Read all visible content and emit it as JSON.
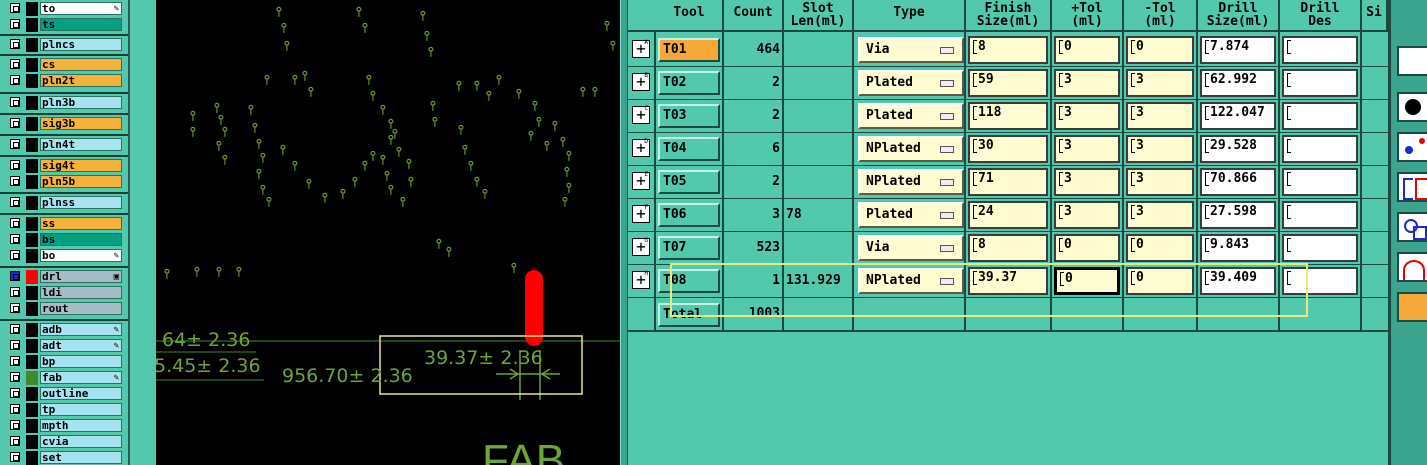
{
  "layers": {
    "items": [
      {
        "name": "to",
        "color": "#ffffff",
        "edit": true
      },
      {
        "name": "ts",
        "color": "#00a080",
        "edit": false
      },
      {
        "name": "plncs",
        "color": "#a8e4f0",
        "edit": false
      },
      {
        "name": "cs",
        "color": "#f7b23b",
        "edit": false
      },
      {
        "name": "pln2t",
        "color": "#f7b23b",
        "edit": false
      },
      {
        "name": "pln3b",
        "color": "#a8e4f0",
        "edit": false
      },
      {
        "name": "sig3b",
        "color": "#f7b23b",
        "edit": false
      },
      {
        "name": "pln4t",
        "color": "#a8e4f0",
        "edit": false
      },
      {
        "name": "sig4t",
        "color": "#f7b23b",
        "edit": false
      },
      {
        "name": "pln5b",
        "color": "#f7b23b",
        "edit": false
      },
      {
        "name": "plnss",
        "color": "#a8e4f0",
        "edit": false
      },
      {
        "name": "ss",
        "color": "#f7b23b",
        "edit": false
      },
      {
        "name": "bs",
        "color": "#00a080",
        "edit": false
      },
      {
        "name": "bo",
        "color": "#ffffff",
        "edit": true
      },
      {
        "name": "drl",
        "color": "#a8bcc8",
        "edit": false
      },
      {
        "name": "ldi",
        "color": "#a8bcc8",
        "edit": false
      },
      {
        "name": "rout",
        "color": "#a8bcc8",
        "edit": false
      },
      {
        "name": "adb",
        "color": "#a8e4f0",
        "edit": true
      },
      {
        "name": "adt",
        "color": "#a8e4f0",
        "edit": true
      },
      {
        "name": "bp",
        "color": "#a8e4f0",
        "edit": false
      },
      {
        "name": "fab",
        "color": "#a8e4f0",
        "edit": true
      },
      {
        "name": "outline",
        "color": "#a8e4f0",
        "edit": false
      },
      {
        "name": "tp",
        "color": "#a8e4f0",
        "edit": false
      },
      {
        "name": "mpth",
        "color": "#a8e4f0",
        "edit": false
      },
      {
        "name": "cvia",
        "color": "#a8e4f0",
        "edit": false
      },
      {
        "name": "set",
        "color": "#a8e4f0",
        "edit": false
      }
    ]
  },
  "canvas": {
    "dims": [
      "64± 2.36",
      "5.45± 2.36",
      "956.70± 2.36",
      "39.37± 2.36"
    ],
    "fab_text": "FAB"
  },
  "table": {
    "headers": [
      {
        "l1": "Tool",
        "l2": ""
      },
      {
        "l1": "Count",
        "l2": ""
      },
      {
        "l1": "Slot",
        "l2": "Len(ml)"
      },
      {
        "l1": "Type",
        "l2": ""
      },
      {
        "l1": "Finish",
        "l2": "Size(ml)"
      },
      {
        "l1": "+Tol",
        "l2": "(ml)"
      },
      {
        "l1": "-Tol",
        "l2": "(ml)"
      },
      {
        "l1": "Drill",
        "l2": "Size(ml)"
      },
      {
        "l1": "Drill",
        "l2": "Des"
      },
      {
        "l1": "Si",
        "l2": ""
      }
    ],
    "rows": [
      {
        "sub": "A",
        "tool": "T01",
        "count": "464",
        "slot": "",
        "type": "Via",
        "finish": "8",
        "plus": "0",
        "minus": "0",
        "drill": "7.874",
        "des": ""
      },
      {
        "sub": "B",
        "tool": "T02",
        "count": "2",
        "slot": "",
        "type": "Plated",
        "finish": "59",
        "plus": "3",
        "minus": "3",
        "drill": "62.992",
        "des": ""
      },
      {
        "sub": "C",
        "tool": "T03",
        "count": "2",
        "slot": "",
        "type": "Plated",
        "finish": "118",
        "plus": "3",
        "minus": "3",
        "drill": "122.047",
        "des": ""
      },
      {
        "sub": "D",
        "tool": "T04",
        "count": "6",
        "slot": "",
        "type": "NPlated",
        "finish": "30",
        "plus": "3",
        "minus": "3",
        "drill": "29.528",
        "des": ""
      },
      {
        "sub": "E",
        "tool": "T05",
        "count": "2",
        "slot": "",
        "type": "NPlated",
        "finish": "71",
        "plus": "3",
        "minus": "3",
        "drill": "70.866",
        "des": ""
      },
      {
        "sub": "F",
        "tool": "T06",
        "count": "3",
        "slot": "78",
        "type": "Plated",
        "finish": "24",
        "plus": "3",
        "minus": "3",
        "drill": "27.598",
        "des": ""
      },
      {
        "sub": "G",
        "tool": "T07",
        "count": "523",
        "slot": "",
        "type": "Via",
        "finish": "8",
        "plus": "0",
        "minus": "0",
        "drill": "9.843",
        "des": ""
      },
      {
        "sub": "H",
        "tool": "T08",
        "count": "1",
        "slot": "131.929",
        "type": "NPlated",
        "finish": "39.37",
        "plus": "0",
        "minus": "0",
        "drill": "39.409",
        "des": ""
      }
    ],
    "total_label": "Total",
    "total_count": "1003"
  }
}
